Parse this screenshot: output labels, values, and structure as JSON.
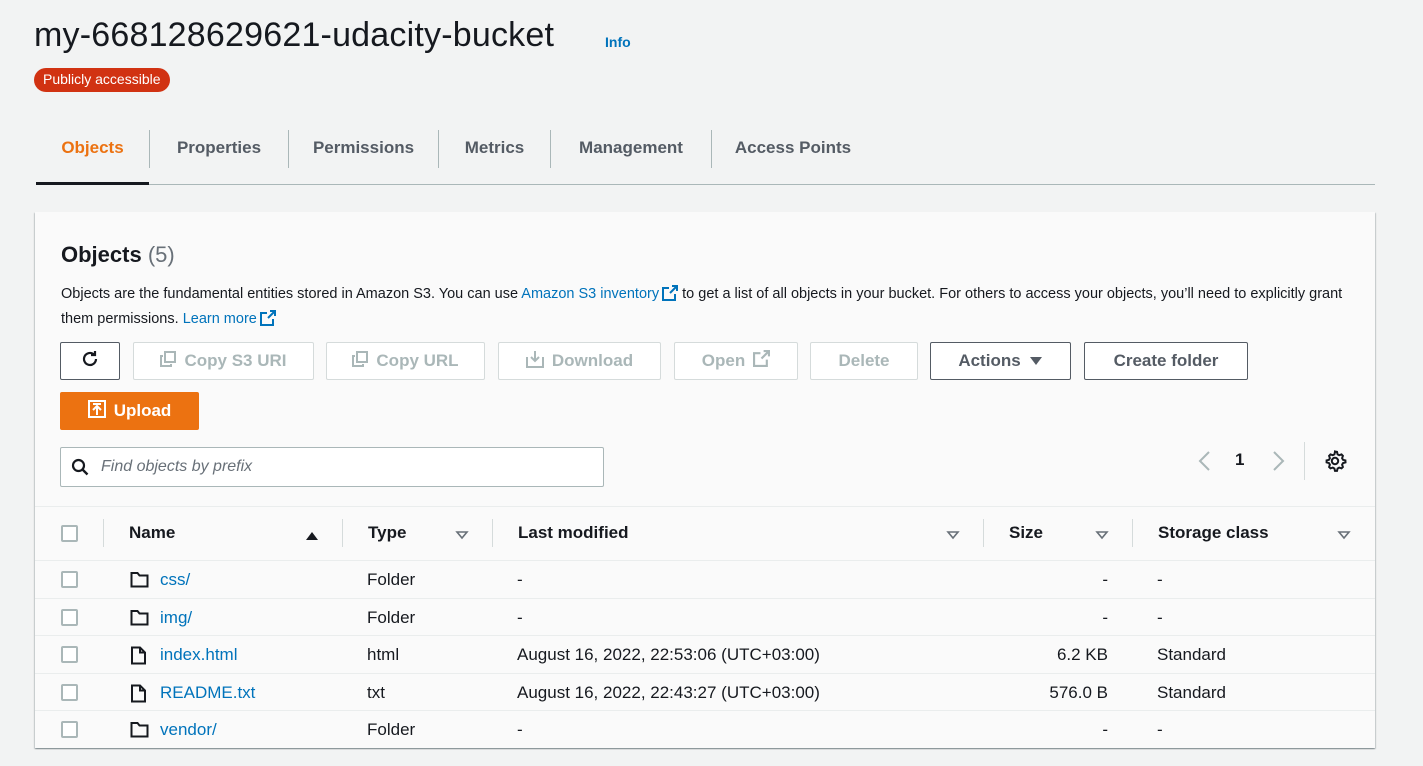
{
  "header": {
    "bucket_name": "my-668128629621-udacity-bucket",
    "info_label": "Info",
    "access_badge": "Publicly accessible"
  },
  "tabs": [
    {
      "label": "Objects",
      "active": true
    },
    {
      "label": "Properties",
      "active": false
    },
    {
      "label": "Permissions",
      "active": false
    },
    {
      "label": "Metrics",
      "active": false
    },
    {
      "label": "Management",
      "active": false
    },
    {
      "label": "Access Points",
      "active": false
    }
  ],
  "panel": {
    "heading": "Objects",
    "count": "(5)",
    "description_1": "Objects are the fundamental entities stored in Amazon S3. You can use ",
    "inventory_link": "Amazon S3 inventory",
    "description_2": " to get a list of all objects in your bucket. For others to access your objects, you’ll need to explicitly grant them permissions. ",
    "learn_more": "Learn more"
  },
  "toolbar": {
    "copy_s3_uri": "Copy S3 URI",
    "copy_url": "Copy URL",
    "download": "Download",
    "open": "Open",
    "delete": "Delete",
    "actions": "Actions",
    "create_folder": "Create folder",
    "upload": "Upload"
  },
  "search": {
    "placeholder": "Find objects by prefix",
    "value": ""
  },
  "pagination": {
    "current_page": "1"
  },
  "table": {
    "columns": [
      "Name",
      "Type",
      "Last modified",
      "Size",
      "Storage class"
    ],
    "rows": [
      {
        "name": "css/",
        "icon": "folder-icon",
        "type": "Folder",
        "last_modified": "-",
        "size": "-",
        "storage_class": "-"
      },
      {
        "name": "img/",
        "icon": "folder-icon",
        "type": "Folder",
        "last_modified": "-",
        "size": "-",
        "storage_class": "-"
      },
      {
        "name": "index.html",
        "icon": "file-icon",
        "type": "html",
        "last_modified": "August 16, 2022, 22:53:06 (UTC+03:00)",
        "size": "6.2 KB",
        "storage_class": "Standard"
      },
      {
        "name": "README.txt",
        "icon": "file-icon",
        "type": "txt",
        "last_modified": "August 16, 2022, 22:43:27 (UTC+03:00)",
        "size": "576.0 B",
        "storage_class": "Standard"
      },
      {
        "name": "vendor/",
        "icon": "folder-icon",
        "type": "Folder",
        "last_modified": "-",
        "size": "-",
        "storage_class": "-"
      }
    ]
  },
  "colors": {
    "accent": "#ec7211",
    "link": "#0073bb",
    "badge": "#d13212",
    "text": "#16191f"
  }
}
